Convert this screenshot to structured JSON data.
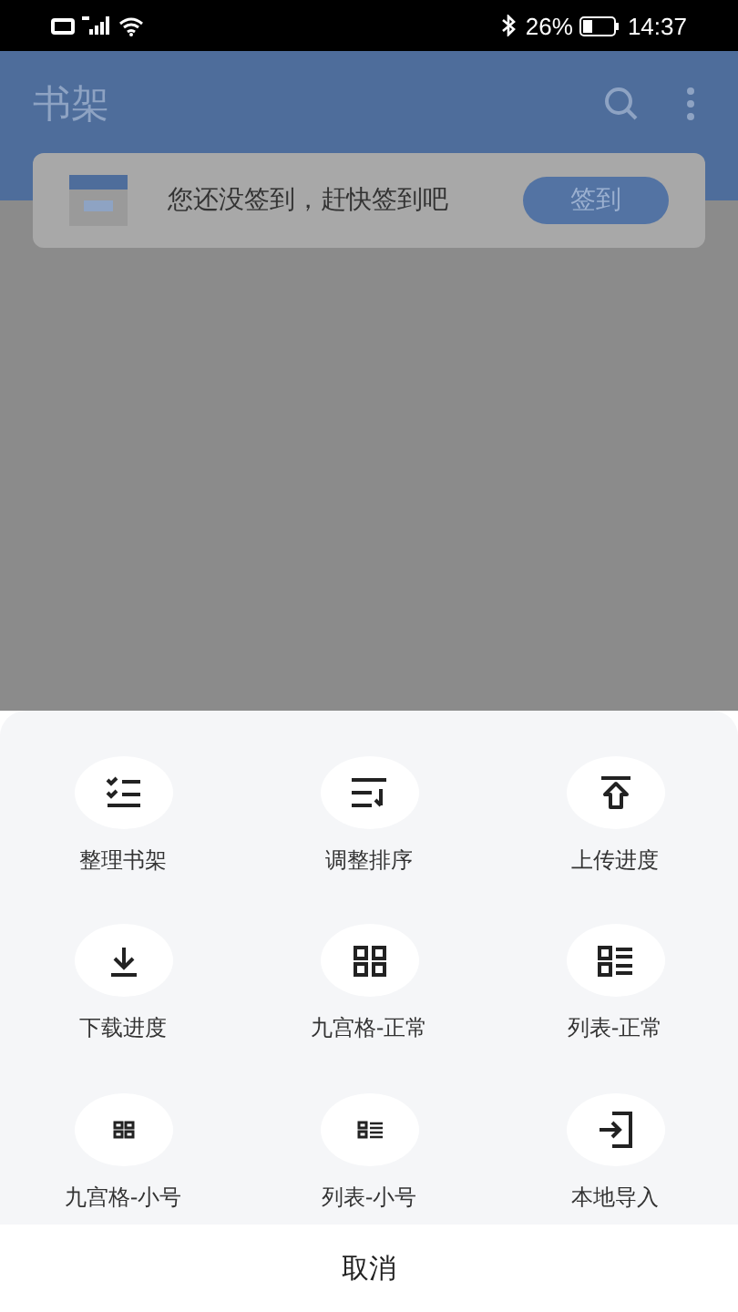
{
  "status_bar": {
    "battery": "26%",
    "time": "14:37"
  },
  "app_bar": {
    "title": "书架"
  },
  "checkin_card": {
    "message": "您还没签到，赶快签到吧",
    "button": "签到"
  },
  "menu": {
    "items": [
      {
        "kind": "organize",
        "label": "整理书架"
      },
      {
        "kind": "sort",
        "label": "调整排序"
      },
      {
        "kind": "upload",
        "label": "上传进度"
      },
      {
        "kind": "download",
        "label": "下载进度"
      },
      {
        "kind": "grid",
        "label": "九宫格-正常"
      },
      {
        "kind": "list",
        "label": "列表-正常"
      },
      {
        "kind": "grid-small",
        "label": "九宫格-小号"
      },
      {
        "kind": "list-small",
        "label": "列表-小号"
      },
      {
        "kind": "import",
        "label": "本地导入"
      }
    ],
    "cancel": "取消"
  }
}
